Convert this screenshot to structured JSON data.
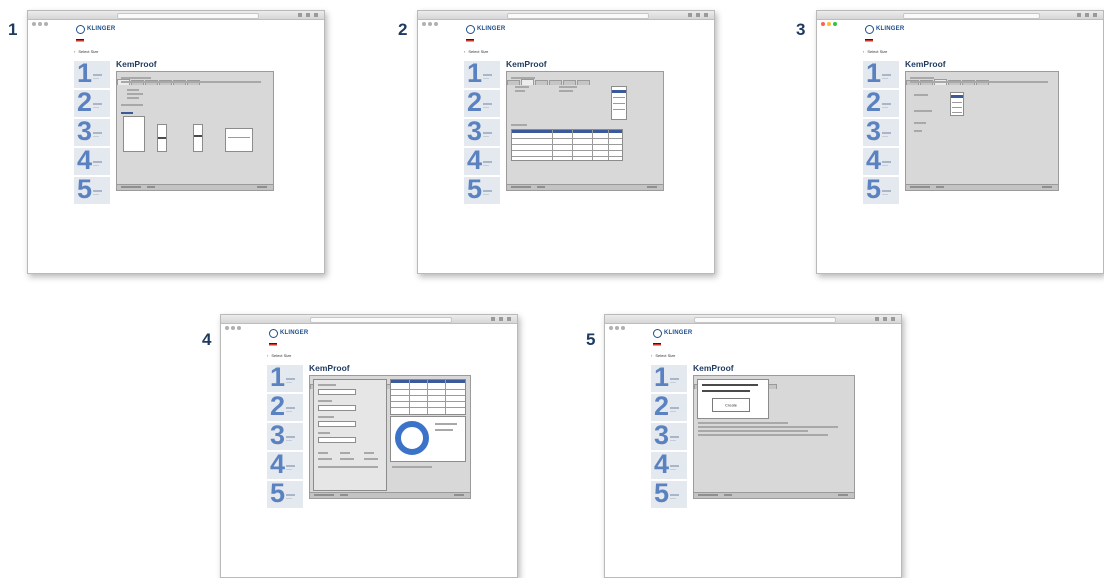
{
  "panels": [
    {
      "number": "1"
    },
    {
      "number": "2"
    },
    {
      "number": "3"
    },
    {
      "number": "4"
    },
    {
      "number": "5"
    }
  ],
  "app": {
    "logo_text": "KLINGER",
    "nav_text": "Select Size",
    "title": "KemProof",
    "steps": [
      "1",
      "2",
      "3",
      "4",
      "5"
    ]
  },
  "panel5": {
    "button_label": "Create"
  }
}
